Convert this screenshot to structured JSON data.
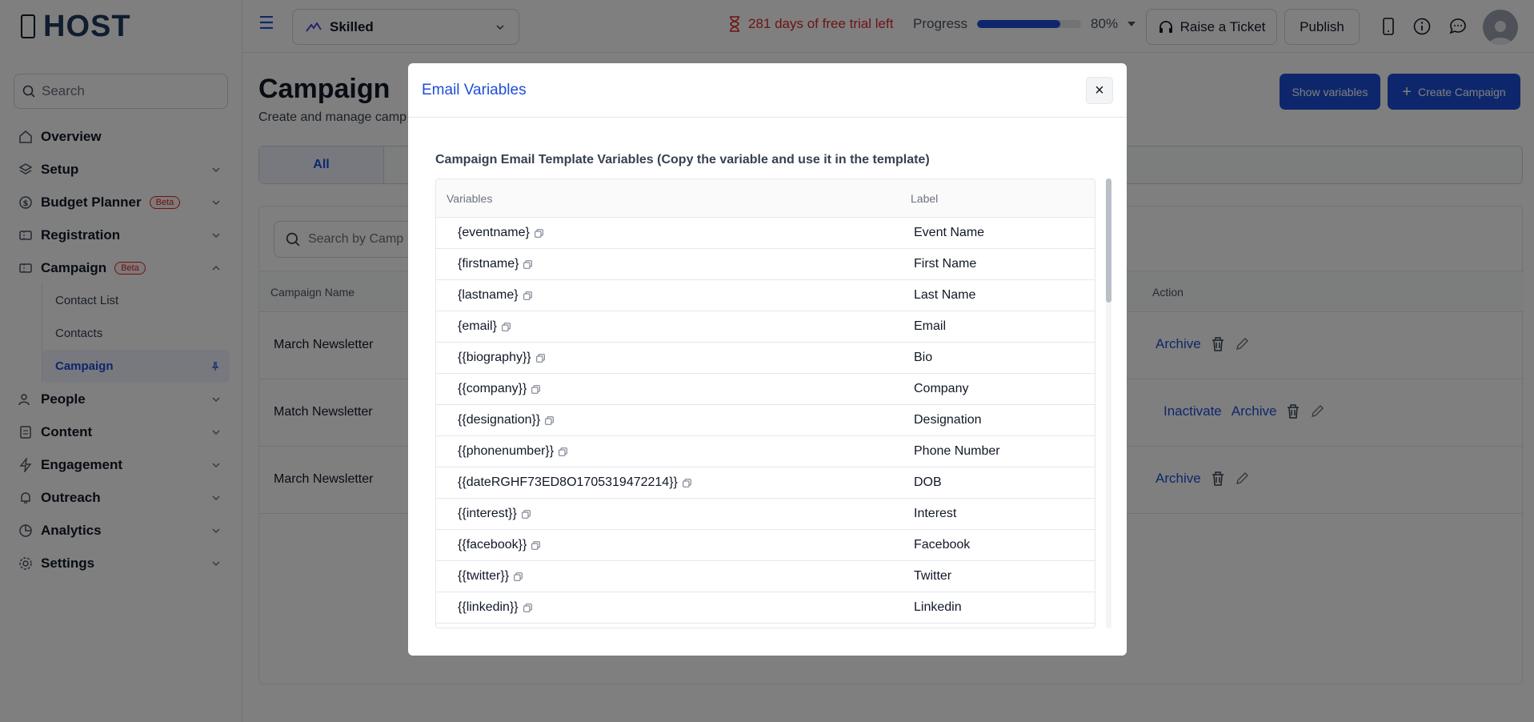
{
  "app": {
    "logo_text": "HOST"
  },
  "sidebar": {
    "search_placeholder": "Search",
    "items": [
      {
        "label": "Overview",
        "icon": "home-icon"
      },
      {
        "label": "Setup",
        "icon": "layers-icon"
      },
      {
        "label": "Budget Planner",
        "icon": "dollar-icon",
        "badge": "Beta"
      },
      {
        "label": "Registration",
        "icon": "ticket-icon"
      },
      {
        "label": "Campaign",
        "icon": "ticket-icon",
        "badge": "Beta"
      },
      {
        "label": "People",
        "icon": "users-icon"
      },
      {
        "label": "Content",
        "icon": "file-icon"
      },
      {
        "label": "Engagement",
        "icon": "bolt-icon"
      },
      {
        "label": "Outreach",
        "icon": "bell-icon"
      },
      {
        "label": "Analytics",
        "icon": "chart-icon"
      },
      {
        "label": "Settings",
        "icon": "gear-icon"
      }
    ],
    "campaign_sub": [
      "Contact List",
      "Contacts",
      "Campaign"
    ]
  },
  "topbar": {
    "event_name": "Skilled",
    "trial_text": "281 days of free trial left",
    "progress_label": "Progress",
    "progress_value": 80,
    "progress_text": "80%",
    "raise_ticket": "Raise a Ticket",
    "publish": "Publish"
  },
  "page": {
    "title": "Campaign",
    "subtitle": "Create and manage camp",
    "show_variables": "Show variables",
    "create_campaign": "Create Campaign",
    "tab_all": "All",
    "search_placeholder": "Search by Camp",
    "col_campaign_name": "Campaign Name",
    "col_action": "Action",
    "rows": [
      {
        "name": "March Newsletter",
        "inactivate": "",
        "archive": "Archive"
      },
      {
        "name": "Match Newsletter",
        "inactivate": "Inactivate",
        "archive": "Archive"
      },
      {
        "name": "March Newsletter",
        "inactivate": "",
        "archive": "Archive"
      }
    ]
  },
  "modal": {
    "title": "Email Variables",
    "close": "×",
    "heading": "Campaign Email Template Variables (Copy the variable and use it in the template)",
    "col_variables": "Variables",
    "col_label": "Label",
    "rows": [
      {
        "variable": "{eventname}",
        "label": "Event Name"
      },
      {
        "variable": "{firstname}",
        "label": "First Name"
      },
      {
        "variable": "{lastname}",
        "label": "Last Name"
      },
      {
        "variable": "{email}",
        "label": "Email"
      },
      {
        "variable": "{{biography}}",
        "label": "Bio"
      },
      {
        "variable": "{{company}}",
        "label": "Company"
      },
      {
        "variable": "{{designation}}",
        "label": "Designation"
      },
      {
        "variable": "{{phonenumber}}",
        "label": "Phone Number"
      },
      {
        "variable": "{{dateRGHF73ED8O1705319472214}}",
        "label": "DOB"
      },
      {
        "variable": "{{interest}}",
        "label": "Interest"
      },
      {
        "variable": "{{facebook}}",
        "label": "Facebook"
      },
      {
        "variable": "{{twitter}}",
        "label": "Twitter"
      },
      {
        "variable": "{{linkedin}}",
        "label": "Linkedin"
      }
    ]
  },
  "colors": {
    "accent": "#1d4ed8",
    "danger": "#dc2626",
    "overlay": "rgba(0,0,0,0.5)"
  }
}
